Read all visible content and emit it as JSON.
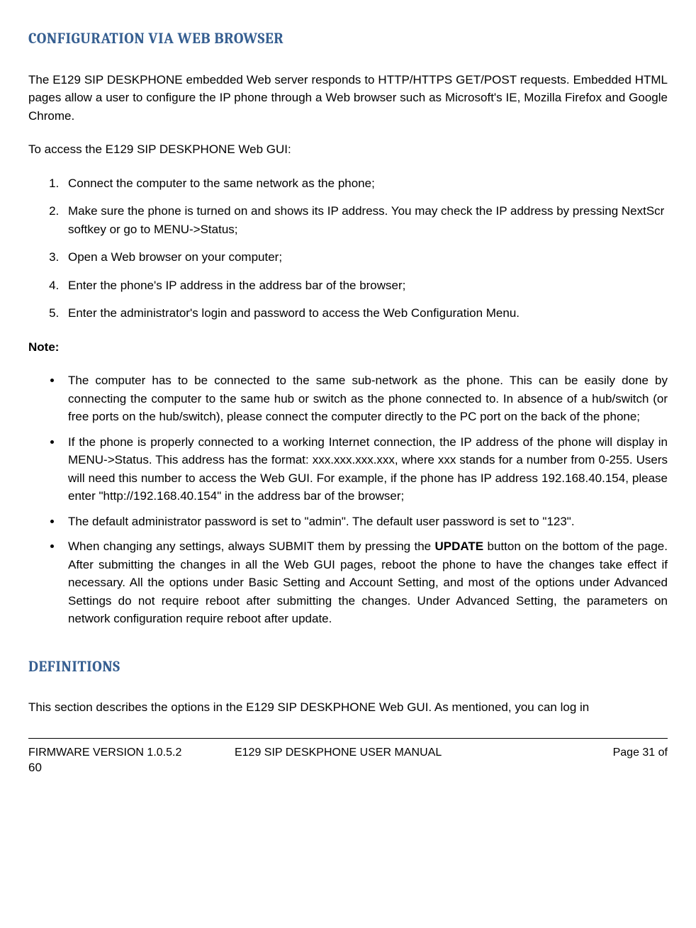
{
  "heading1": "CONFIGURATION VIA WEB BROWSER",
  "para1": "The E129 SIP DESKPHONE embedded Web server responds to HTTP/HTTPS GET/POST requests. Embedded HTML pages allow a user to configure the IP phone through a Web browser such as Microsoft's IE, Mozilla Firefox and Google Chrome.",
  "para2": "To access the E129 SIP DESKPHONE Web GUI:",
  "steps": [
    "Connect the computer to the same network as the phone;",
    "Make sure the phone is turned on and shows its IP address. You may check the IP address by pressing NextScr softkey or go to MENU->Status;",
    "Open a Web browser on your computer;",
    "Enter the phone's IP address in the address bar of the browser;",
    "Enter the administrator's login and password to access the Web Configuration Menu."
  ],
  "note_label": "Note:",
  "bullets": {
    "b1": "The computer has to be connected to the same sub-network as the phone. This can be easily done by connecting the computer to the same hub or switch as the phone connected to. In absence of a hub/switch (or free ports on the hub/switch), please connect the computer directly to the PC port on the back of the phone;",
    "b2": "If the phone is properly connected to a working Internet connection, the IP address of the phone will display in MENU->Status. This address has the format: xxx.xxx.xxx.xxx, where xxx stands for a number from 0-255. Users will need this number to access the Web GUI. For example, if the phone has IP address 192.168.40.154, please enter \"http://192.168.40.154\" in the address bar of the browser;",
    "b3": "The default administrator password is set to \"admin\". The default user password is set to \"123\".",
    "b4_pre": "When changing any settings, always SUBMIT them by pressing the ",
    "b4_bold": "UPDATE",
    "b4_post": " button on the bottom of the page. After submitting the changes in all the Web GUI pages, reboot the phone to have the changes take effect if necessary. All the options under Basic Setting and Account Setting, and most of the options under Advanced Settings do not require reboot after submitting the changes. Under Advanced Setting, the parameters on network configuration require reboot after update."
  },
  "heading2": "DEFINITIONS",
  "para3": "This section describes the options in the E129 SIP DESKPHONE Web GUI. As mentioned, you can log in",
  "footer": {
    "left": "FIRMWARE VERSION 1.0.5.2",
    "center": "E129 SIP DESKPHONE USER MANUAL",
    "right": "Page 31 of",
    "total": "60"
  }
}
